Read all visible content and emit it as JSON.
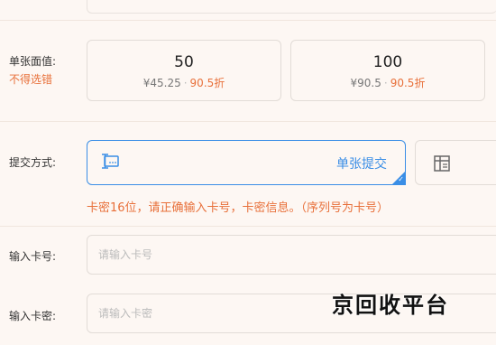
{
  "denomination": {
    "label": "单张面值:",
    "note": "不得选错",
    "options": [
      {
        "value": "50",
        "price": "¥45.25",
        "discount": "90.5折"
      },
      {
        "value": "100",
        "price": "¥90.5",
        "discount": "90.5折"
      }
    ]
  },
  "submit_method": {
    "label": "提交方式:",
    "options": [
      {
        "label": "单张提交",
        "icon": "single-card-icon",
        "selected": true
      },
      {
        "label": "",
        "icon": "batch-card-icon",
        "selected": false
      }
    ]
  },
  "hint": "卡密16位，请正确输入卡号，卡密信息。（序列号为卡号）",
  "card_number": {
    "label": "输入卡号:",
    "placeholder": "请输入卡号"
  },
  "card_password": {
    "label": "输入卡密:",
    "placeholder": "请输入卡密"
  },
  "watermark": "京回收平台",
  "colors": {
    "accent": "#3a8ee6",
    "warning": "#e8703a",
    "background": "#fdf7f3"
  }
}
